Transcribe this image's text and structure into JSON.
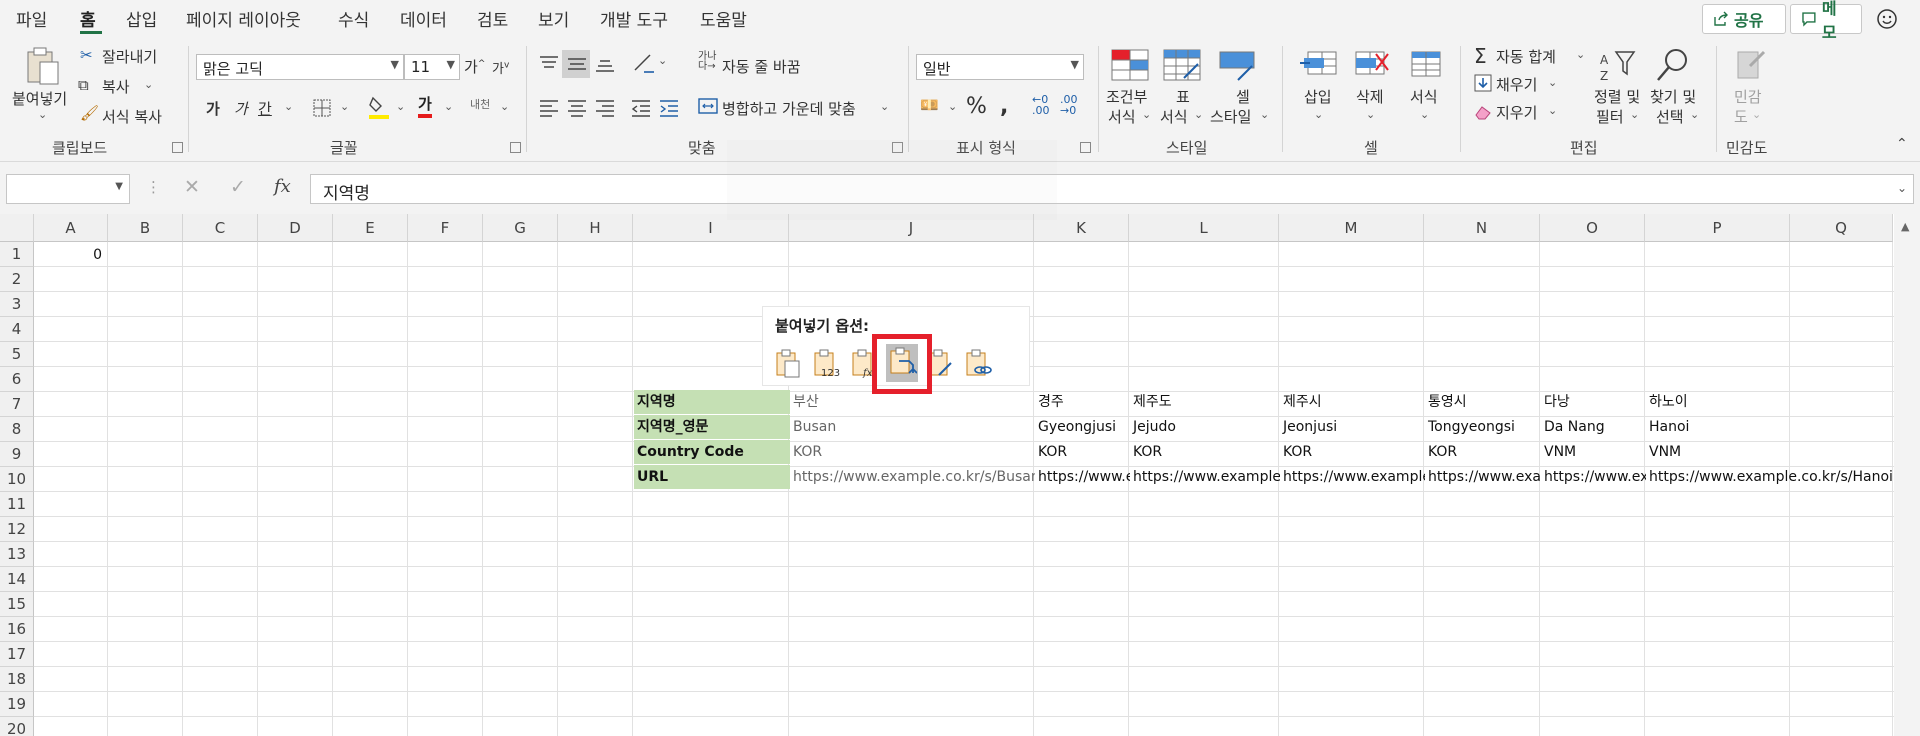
{
  "menu": {
    "tabs": [
      "파일",
      "홈",
      "삽입",
      "페이지 레이아웃",
      "수식",
      "데이터",
      "검토",
      "보기",
      "개발 도구",
      "도움말"
    ],
    "share_label": "공유",
    "memo_label": "메모"
  },
  "ribbon": {
    "clipboard": {
      "paste_label": "붙여넣기",
      "cut_label": "잘라내기",
      "copy_label": "복사",
      "format_painter_label": "서식 복사",
      "group_label": "클립보드"
    },
    "font": {
      "font_name": "맑은 고딕",
      "font_size": "11",
      "bold_label": "가",
      "italic_label": "가",
      "underline_label": "간",
      "font_color_label": "가",
      "phonetic_label": "내천",
      "group_label": "글꼴"
    },
    "alignment": {
      "wrap_text_label": "자동 줄 바꿈",
      "merge_label": "병합하고 가운데 맞춤",
      "group_label": "맞춤"
    },
    "number": {
      "format": "일반",
      "group_label": "표시 형식"
    },
    "styles": {
      "conditional_label_1": "조건부",
      "conditional_label_2": "서식",
      "table_label_1": "표",
      "table_label_2": "서식",
      "cell_label_1": "셀",
      "cell_label_2": "스타일",
      "group_label": "스타일"
    },
    "cells": {
      "insert_label": "삽입",
      "delete_label": "삭제",
      "format_label": "서식",
      "group_label": "셀"
    },
    "editing": {
      "autosum_label": "자동 합계",
      "fill_label": "채우기",
      "clear_label": "지우기",
      "sort_label_1": "정렬 및",
      "sort_label_2": "필터",
      "find_label_1": "찾기 및",
      "find_label_2": "선택",
      "group_label": "편집"
    },
    "sensitivity": {
      "label_1": "민감",
      "label_2": "도",
      "group_label": "민감도"
    }
  },
  "formula_bar": {
    "name_box": "",
    "fx_label": "fx",
    "content": "지역명"
  },
  "columns": [
    "A",
    "B",
    "C",
    "D",
    "E",
    "F",
    "G",
    "H",
    "I",
    "J",
    "K",
    "L",
    "M",
    "N",
    "O",
    "P",
    "Q"
  ],
  "rows": [
    "1",
    "2",
    "3",
    "4",
    "5",
    "6",
    "7",
    "8",
    "9",
    "10",
    "11",
    "12",
    "13",
    "14",
    "15",
    "16",
    "17",
    "18",
    "19",
    "20"
  ],
  "cells": {
    "a1": "0",
    "i7": "지역명",
    "i8": "지역명_영문",
    "i9": "Country Code",
    "i10": "URL",
    "j7": "부산",
    "j8": "Busan",
    "j9": "KOR",
    "j10": "https://www.example.co.kr/s/Busan",
    "k7": "경주",
    "k8": "Gyeongjusi",
    "k9": "KOR",
    "k10": "https://www.ex",
    "l7": "제주도",
    "l8": "Jejudo",
    "l9": "KOR",
    "l10": "https://www.example.co",
    "m7": "제주시",
    "m8": "Jeonjusi",
    "m9": "KOR",
    "m10": "https://www.example.c",
    "n7": "통영시",
    "n8": "Tongyeongsi",
    "n9": "KOR",
    "n10": "https://www.exam",
    "o7": "다낭",
    "o8": "Da Nang",
    "o9": "VNM",
    "o10": "https://www.exa",
    "p7": "하노이",
    "p8": "Hanoi",
    "p9": "VNM",
    "p10": "https://www.example.co.kr/s/Hanoi"
  },
  "paste_options": {
    "title": "붙여넣기 옵션:",
    "icons": [
      "paste-icon",
      "paste-values-icon",
      "paste-formulas-icon",
      "paste-transpose-icon",
      "paste-formatting-icon",
      "paste-link-icon"
    ],
    "selected": "paste-transpose-icon"
  },
  "colors": {
    "accent": "#217346",
    "header_fill": "#c5e0b4",
    "highlight_box": "#e5202b"
  }
}
